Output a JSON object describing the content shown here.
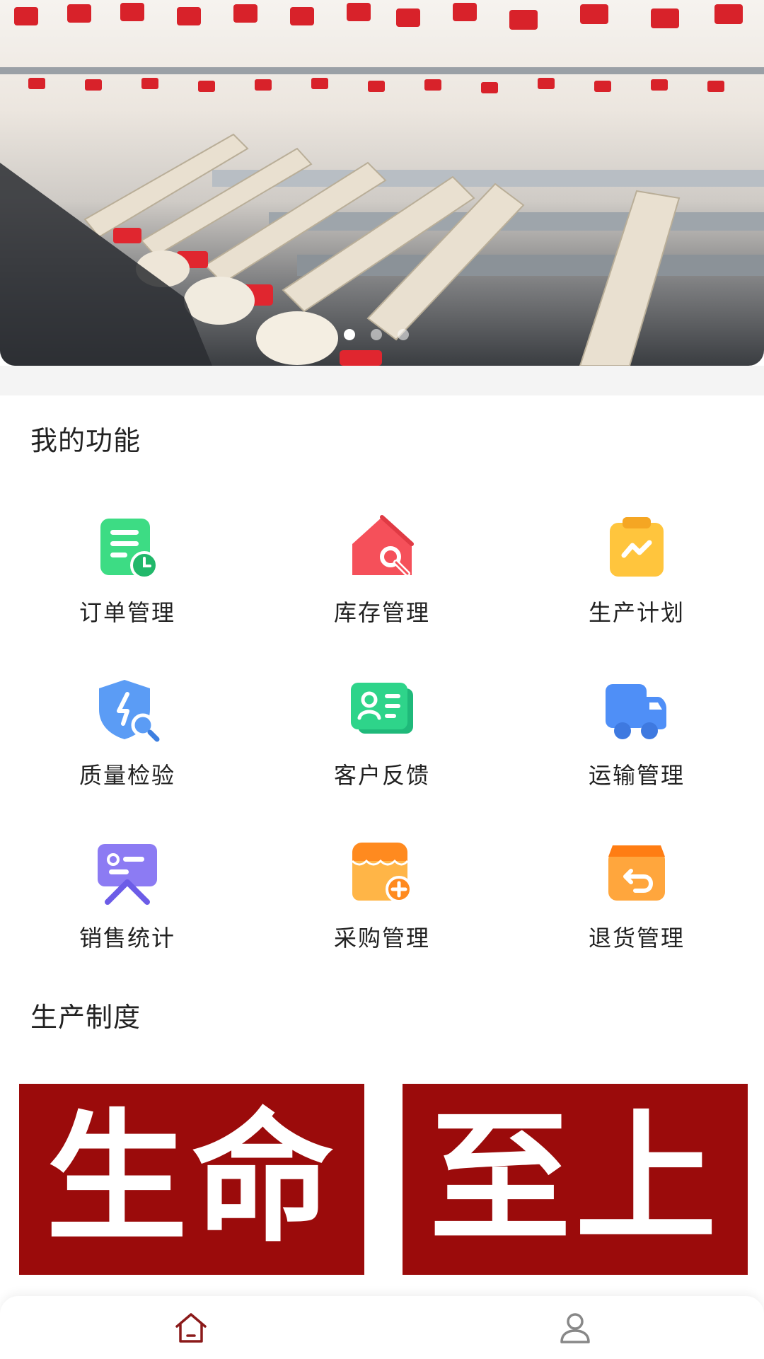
{
  "banner": {
    "carousel": {
      "count": 3,
      "active_index": 0
    }
  },
  "sections": {
    "functions_title": "我的功能",
    "rules_title": "生产制度"
  },
  "functions": [
    {
      "label": "订单管理",
      "icon": "order-doc-icon",
      "color": "#3ddc84"
    },
    {
      "label": "库存管理",
      "icon": "inventory-house-icon",
      "color": "#f5505a"
    },
    {
      "label": "生产计划",
      "icon": "plan-clipboard-icon",
      "color": "#ffc53d"
    },
    {
      "label": "质量检验",
      "icon": "quality-shield-icon",
      "color": "#5b9cf5"
    },
    {
      "label": "客户反馈",
      "icon": "customer-card-icon",
      "color": "#2ed48a"
    },
    {
      "label": "运输管理",
      "icon": "truck-icon",
      "color": "#4f8ff7"
    },
    {
      "label": "销售统计",
      "icon": "sales-board-icon",
      "color": "#8c7bf3"
    },
    {
      "label": "采购管理",
      "icon": "purchase-store-icon",
      "color": "#ffa23a"
    },
    {
      "label": "退货管理",
      "icon": "return-box-icon",
      "color": "#ff9530"
    }
  ],
  "posters": [
    {
      "text": "生命"
    },
    {
      "text": "至上"
    }
  ],
  "poster_color": "#9b0b0b",
  "nav": {
    "items": [
      {
        "name": "home",
        "icon": "home-icon",
        "active": true
      },
      {
        "name": "profile",
        "icon": "user-icon",
        "active": false
      }
    ],
    "active_color": "#8b1a1a",
    "inactive_color": "#888888"
  }
}
